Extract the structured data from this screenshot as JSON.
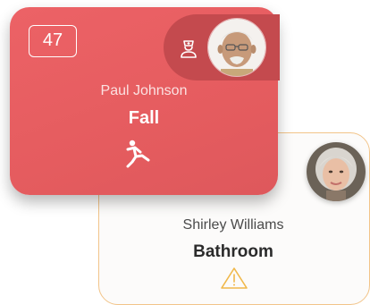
{
  "cards": [
    {
      "room": "47",
      "resident": "Paul Johnson",
      "alert": "Fall",
      "alert_icon": "fall-person-icon",
      "staff_icon": "nurse-icon",
      "accent": "#e55c5f"
    },
    {
      "resident": "Shirley Williams",
      "alert": "Bathroom",
      "alert_icon": "warning-triangle-icon",
      "accent": "#f2c489"
    }
  ]
}
